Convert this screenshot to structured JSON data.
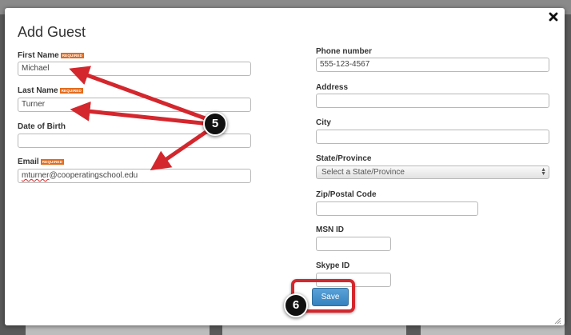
{
  "dialog": {
    "title": "Add Guest",
    "required_tag": "REQUIRED",
    "close_icon": "close-x-icon",
    "resize_icon": "resize-grip-icon"
  },
  "left_fields": {
    "first_name": {
      "label": "First Name",
      "value": "Michael",
      "required": true
    },
    "last_name": {
      "label": "Last Name",
      "value": "Turner",
      "required": true
    },
    "date_of_birth": {
      "label": "Date of Birth",
      "value": ""
    },
    "email": {
      "label": "Email",
      "value": "mturner@cooperatingschool.edu",
      "value_start": "mturner",
      "value_rest": "@cooperatingschool.edu",
      "required": true
    }
  },
  "right_fields": {
    "phone": {
      "label": "Phone number",
      "value": "555-123-4567"
    },
    "address": {
      "label": "Address",
      "value": ""
    },
    "city": {
      "label": "City",
      "value": ""
    },
    "state": {
      "label": "State/Province",
      "selected": "Select a State/Province"
    },
    "zip": {
      "label": "Zip/Postal Code",
      "value": ""
    },
    "msn": {
      "label": "MSN ID",
      "value": ""
    },
    "skype": {
      "label": "Skype ID",
      "value": ""
    }
  },
  "actions": {
    "save_label": "Save"
  },
  "annotations": {
    "step_fields": "5",
    "step_save": "6",
    "arrow_color": "#d3272d",
    "highlight_color": "#d3272d"
  }
}
